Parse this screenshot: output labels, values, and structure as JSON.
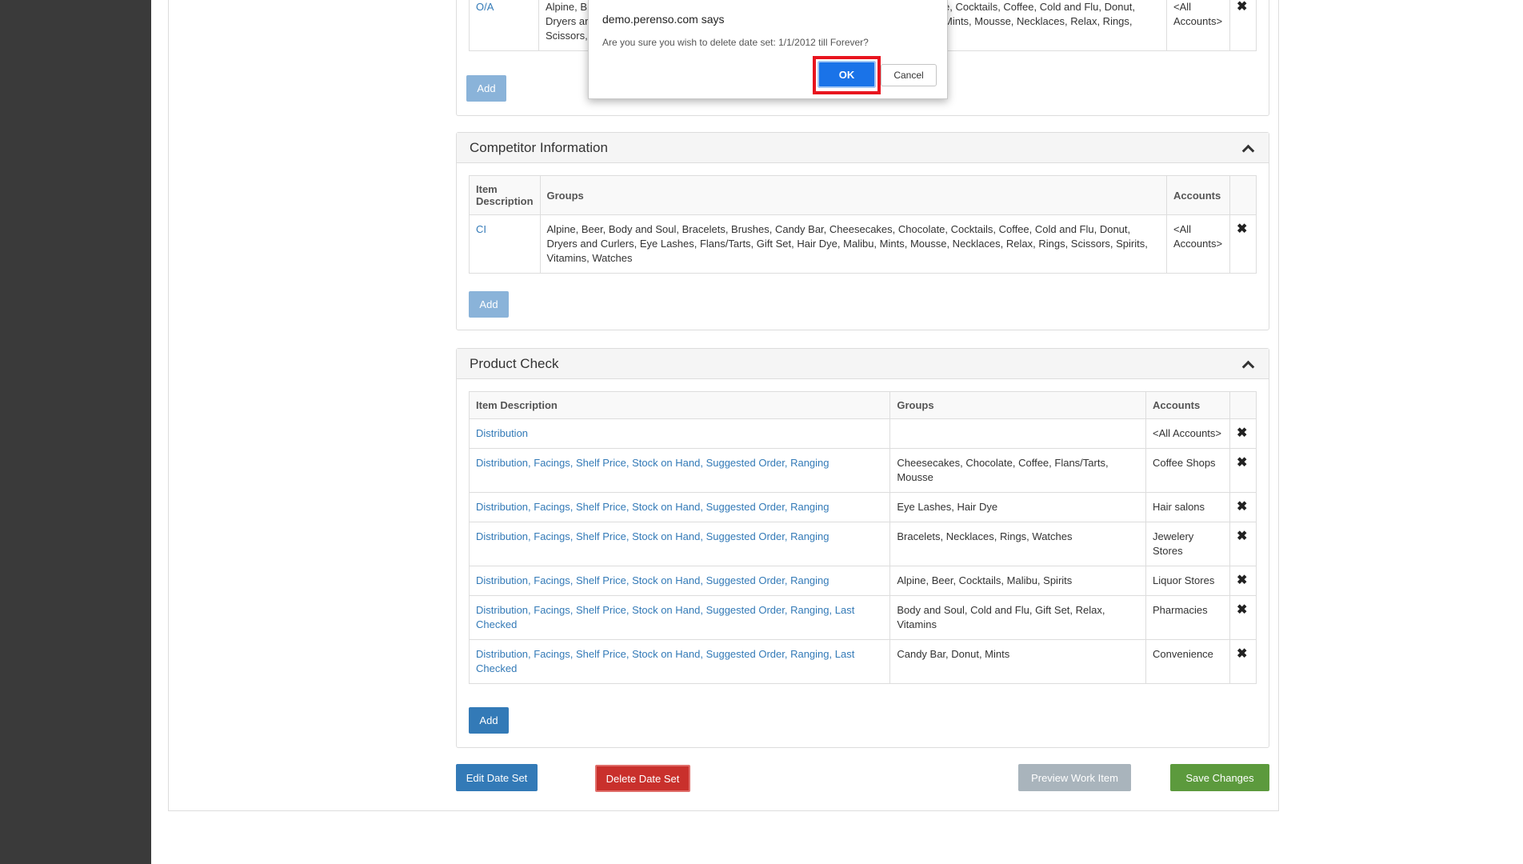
{
  "dialog": {
    "title": "demo.perenso.com says",
    "message": "Are you sure you wish to delete date set: 1/1/2012 till Forever?",
    "ok_label": "OK",
    "cancel_label": "Cancel"
  },
  "top_section": {
    "rows": [
      {
        "item": "O/A",
        "groups_left": "Alpine, B",
        "groups_left2": "Dryers ar",
        "groups_left3": "Scissors,",
        "groups_right": "e, Cocktails, Coffee, Cold and Flu, Donut,",
        "groups_right2": "Mints, Mousse, Necklaces, Relax, Rings,",
        "accounts": "<All Accounts>",
        "delete": "✖"
      }
    ],
    "add_label": "Add"
  },
  "competitor": {
    "title": "Competitor Information",
    "columns": {
      "item": "Item Description",
      "groups": "Groups",
      "accounts": "Accounts"
    },
    "rows": [
      {
        "item": "CI",
        "groups": "Alpine, Beer, Body and Soul, Bracelets, Brushes, Candy Bar, Cheesecakes, Chocolate, Cocktails, Coffee, Cold and Flu, Donut, Dryers and Curlers, Eye Lashes, Flans/Tarts, Gift Set, Hair Dye, Malibu, Mints, Mousse, Necklaces, Relax, Rings, Scissors, Spirits, Vitamins, Watches",
        "accounts": "<All Accounts>",
        "delete": "✖"
      }
    ],
    "add_label": "Add"
  },
  "product_check": {
    "title": "Product Check",
    "columns": {
      "item": "Item Description",
      "groups": "Groups",
      "accounts": "Accounts"
    },
    "rows": [
      {
        "item": "Distribution",
        "groups": "",
        "accounts": "<All Accounts>",
        "delete": "✖"
      },
      {
        "item": "Distribution, Facings, Shelf Price, Stock on Hand, Suggested Order, Ranging",
        "groups": "Cheesecakes, Chocolate, Coffee, Flans/Tarts, Mousse",
        "accounts": "Coffee Shops",
        "delete": "✖"
      },
      {
        "item": "Distribution, Facings, Shelf Price, Stock on Hand, Suggested Order, Ranging",
        "groups": "Eye Lashes, Hair Dye",
        "accounts": "Hair salons",
        "delete": "✖"
      },
      {
        "item": "Distribution, Facings, Shelf Price, Stock on Hand, Suggested Order, Ranging",
        "groups": "Bracelets, Necklaces, Rings, Watches",
        "accounts": "Jewelery Stores",
        "delete": "✖"
      },
      {
        "item": "Distribution, Facings, Shelf Price, Stock on Hand, Suggested Order, Ranging",
        "groups": "Alpine, Beer, Cocktails, Malibu, Spirits",
        "accounts": "Liquor Stores",
        "delete": "✖"
      },
      {
        "item": "Distribution, Facings, Shelf Price, Stock on Hand, Suggested Order, Ranging, Last Checked",
        "groups": "Body and Soul, Cold and Flu, Gift Set, Relax, Vitamins",
        "accounts": "Pharmacies",
        "delete": "✖"
      },
      {
        "item": "Distribution, Facings, Shelf Price, Stock on Hand, Suggested Order, Ranging, Last Checked",
        "groups": "Candy Bar, Donut, Mints",
        "accounts": "Convenience",
        "delete": "✖"
      }
    ],
    "add_label": "Add"
  },
  "footer": {
    "edit_label": "Edit Date Set",
    "delete_label": "Delete Date Set",
    "preview_label": "Preview Work Item",
    "save_label": "Save Changes"
  },
  "colors": {
    "primary": "#337ab7",
    "danger": "#c9302c",
    "success": "#5c9a3d",
    "disabled": "#a9b4bc",
    "highlight": "#e8141e",
    "sidebar": "#3a3a3a"
  }
}
